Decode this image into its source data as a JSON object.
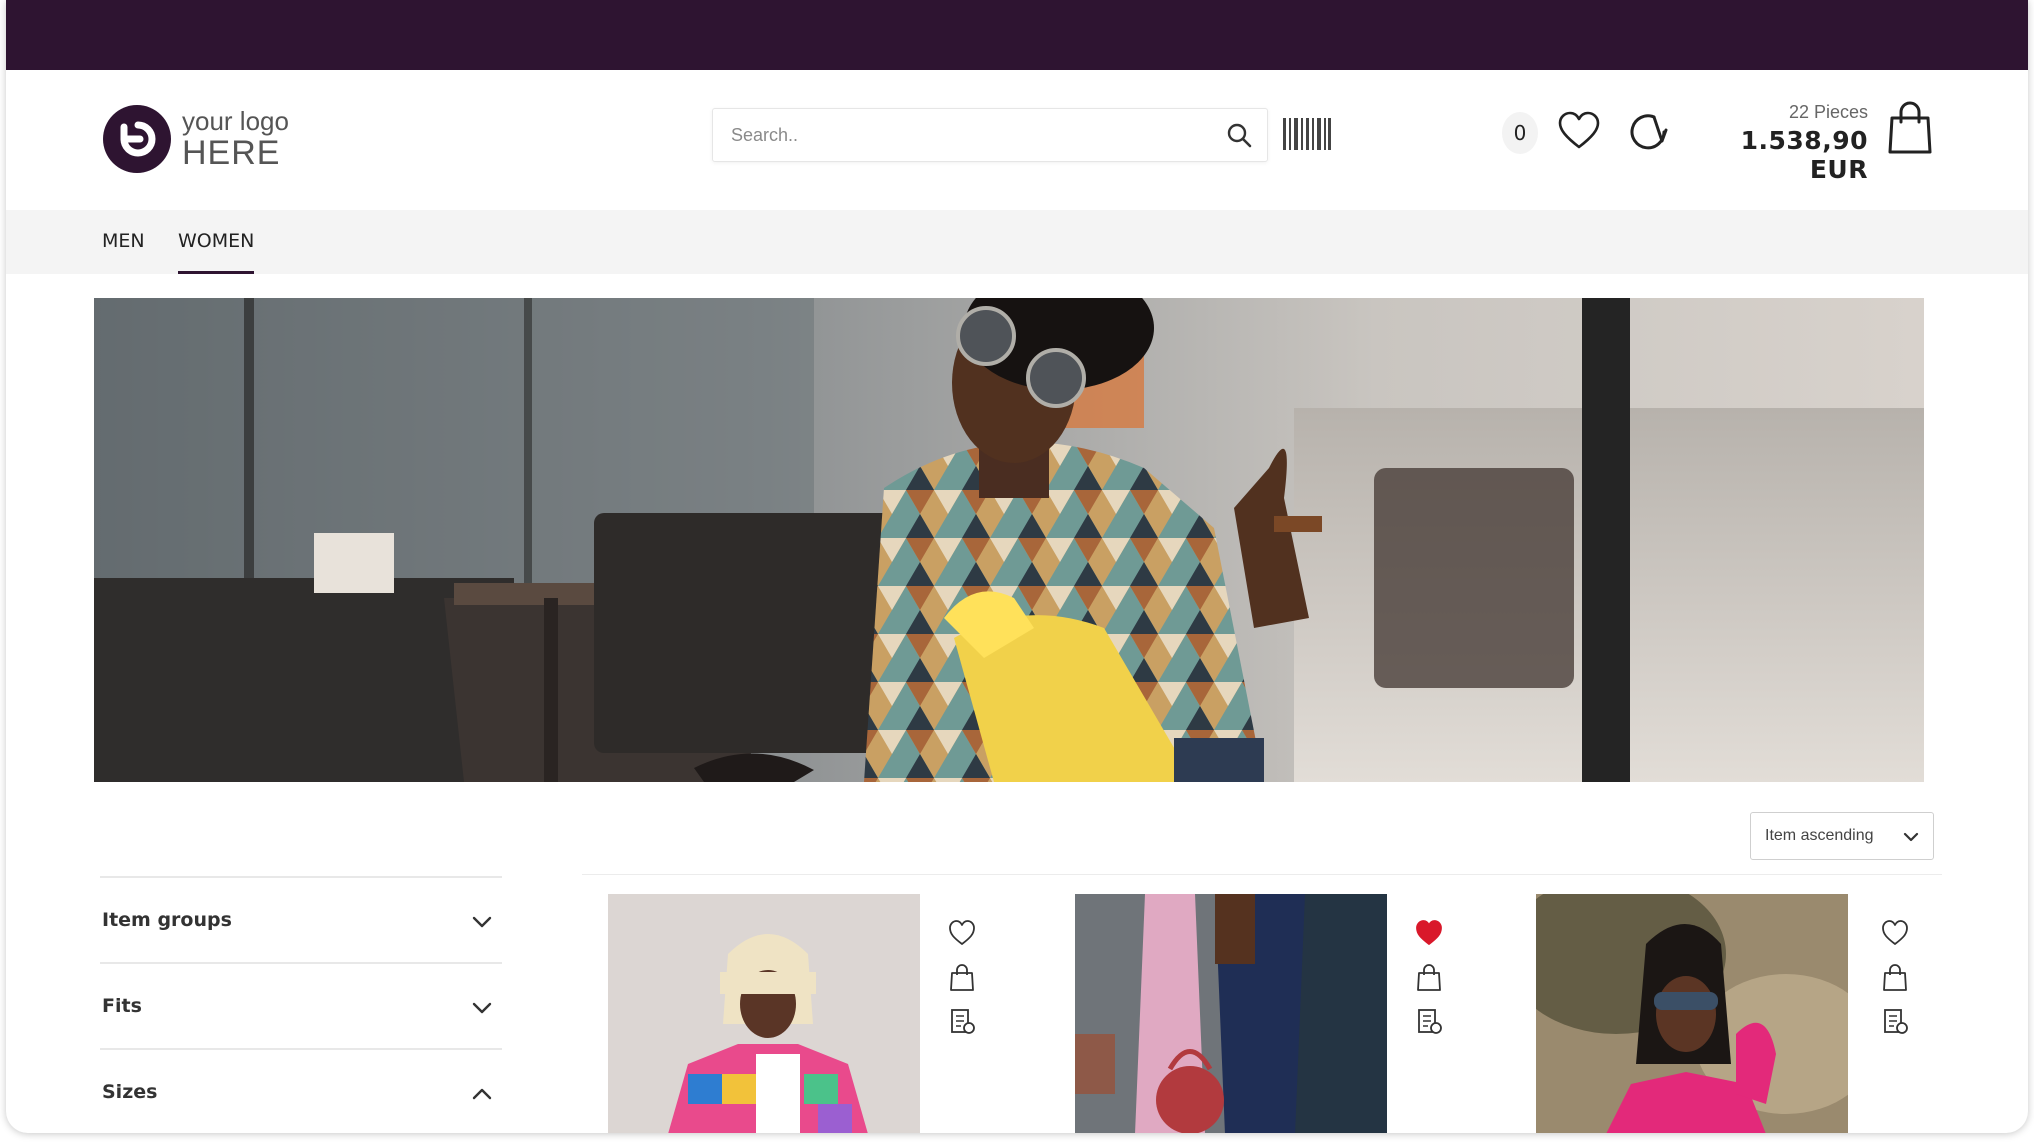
{
  "header": {
    "logo": {
      "line1": "your logo",
      "line2": "HERE"
    },
    "search": {
      "placeholder": "Search.."
    },
    "counter": "0",
    "cart": {
      "pieces": "22 Pieces",
      "total": "1.538,90 EUR"
    }
  },
  "nav": {
    "items": [
      {
        "label": "MEN"
      },
      {
        "label": "WOMEN",
        "active": true
      }
    ]
  },
  "sort": {
    "selected": "Item ascending"
  },
  "filters": [
    {
      "label": "Item groups",
      "expanded": false
    },
    {
      "label": "Fits",
      "expanded": false
    },
    {
      "label": "Sizes",
      "expanded": true
    }
  ],
  "products": [
    {
      "favorited": false
    },
    {
      "favorited": true
    },
    {
      "favorited": false
    }
  ],
  "colors": {
    "brand": "#2e1431",
    "favorite": "#d9182a"
  },
  "icons": [
    "search-icon",
    "barcode-icon",
    "heart-icon",
    "reload-icon",
    "shopping-bag-icon",
    "chevron-down-icon",
    "chevron-up-icon",
    "compare-list-icon"
  ]
}
